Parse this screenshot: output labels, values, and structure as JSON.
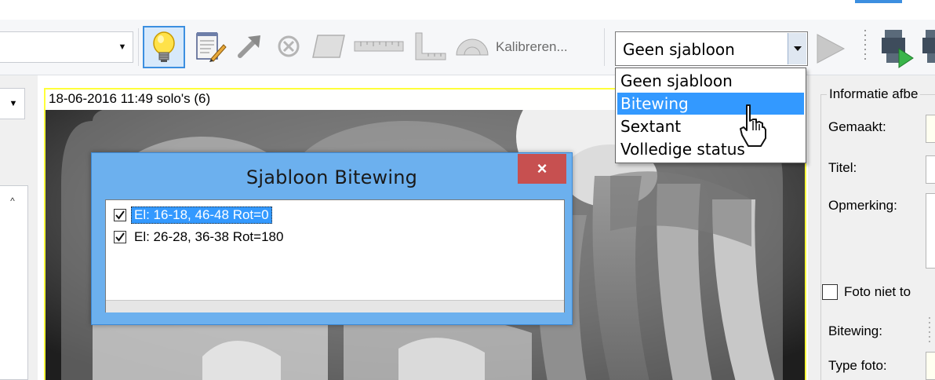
{
  "toolbar": {
    "kalibreren_label": "Kalibreren...",
    "template_combo": {
      "selected": "Geen sjabloon"
    },
    "icons": [
      "lightbulb-icon",
      "notepad-pencil-icon",
      "arrow-icon",
      "cancel-circle-icon",
      "rectangle-shape-icon",
      "ruler-icon",
      "set-square-icon",
      "protractor-icon",
      "play-icon",
      "run-tool-icon"
    ]
  },
  "dropdown": {
    "options": [
      "Geen sjabloon",
      "Bitewing",
      "Sextant",
      "Volledige status"
    ],
    "highlighted_index": 1
  },
  "image": {
    "caption": "18-06-2016 11:49 solo's (6)"
  },
  "dialog": {
    "title": "Sjabloon Bitewing",
    "close_glyph": "×",
    "items": [
      {
        "checked": true,
        "label": "El: 16-18, 46-48 Rot=0"
      },
      {
        "checked": true,
        "label": "El: 26-28, 36-38 Rot=180"
      }
    ],
    "selected_index": 0
  },
  "right_panel": {
    "group_title": "Informatie afbe",
    "gemaakt_label": "Gemaakt:",
    "titel_label": "Titel:",
    "opmerking_label": "Opmerking:",
    "foto_label": "Foto niet to",
    "bitewing_label": "Bitewing:",
    "type_label": "Type foto:"
  },
  "colors": {
    "accent": "#3c8fe0",
    "selection": "#3399ff",
    "dialog_frame": "#6cb0ee",
    "close_button": "#c75050",
    "image_border": "#ffff3a"
  }
}
